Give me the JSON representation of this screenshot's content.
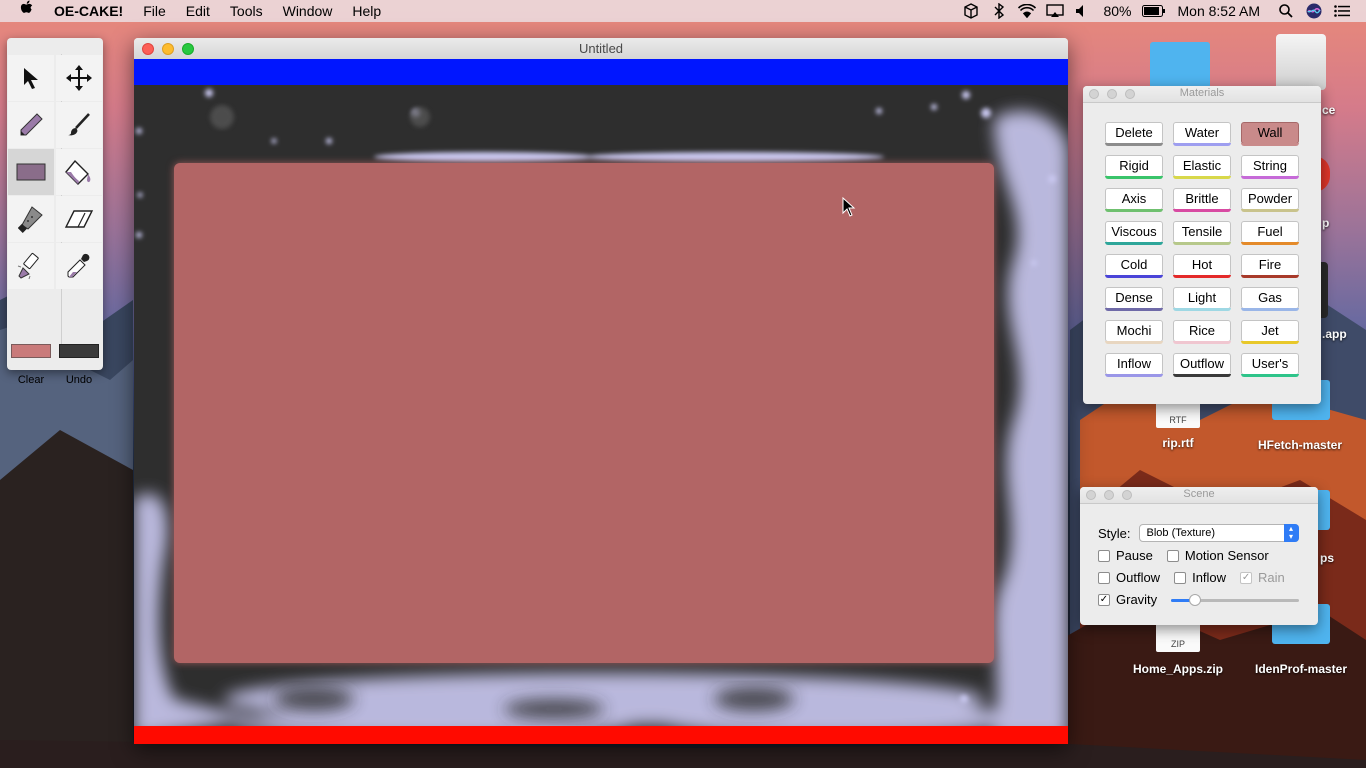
{
  "menubar": {
    "app_name": "OE-CAKE!",
    "menus": [
      "File",
      "Edit",
      "Tools",
      "Window",
      "Help"
    ],
    "battery": "80%",
    "clock": "Mon 8:52 AM",
    "icons": [
      "apple-icon",
      "box-icon",
      "bluetooth-icon",
      "wifi-icon",
      "airplay-icon",
      "volume-icon",
      "battery-icon",
      "search-icon",
      "siri-icon",
      "list-icon"
    ]
  },
  "palette": {
    "tools": [
      "select-arrow-icon",
      "move-icon",
      "pencil-icon",
      "brush-icon",
      "rectangle-icon",
      "paint-bucket-icon",
      "knife-icon",
      "eraser-icon",
      "flashlight-icon",
      "dropper-icon"
    ],
    "selected_tool": "rectangle-icon",
    "foreground_color": "#c97a7a",
    "background_color": "#3a3a3a",
    "clear_label": "Clear",
    "undo_label": "Undo"
  },
  "window": {
    "title": "Untitled"
  },
  "materials": {
    "title": "Materials",
    "selected": "Wall",
    "items": [
      {
        "label": "Delete",
        "color": "#8c8c8c"
      },
      {
        "label": "Water",
        "color": "#9e9ef0"
      },
      {
        "label": "Wall",
        "color": "#c98a8a"
      },
      {
        "label": "Rigid",
        "color": "#39c46a"
      },
      {
        "label": "Elastic",
        "color": "#d8d84a"
      },
      {
        "label": "String",
        "color": "#c66ad8"
      },
      {
        "label": "Axis",
        "color": "#6fc06f"
      },
      {
        "label": "Brittle",
        "color": "#d84aa2"
      },
      {
        "label": "Powder",
        "color": "#c9c38c"
      },
      {
        "label": "Viscous",
        "color": "#2ea69a"
      },
      {
        "label": "Tensile",
        "color": "#b6c88a"
      },
      {
        "label": "Fuel",
        "color": "#e48a2a"
      },
      {
        "label": "Cold",
        "color": "#4a44d8"
      },
      {
        "label": "Hot",
        "color": "#e42a2a"
      },
      {
        "label": "Fire",
        "color": "#a83a2a"
      },
      {
        "label": "Dense",
        "color": "#6f6aa8"
      },
      {
        "label": "Light",
        "color": "#9ed8e4"
      },
      {
        "label": "Gas",
        "color": "#9ab6e8"
      },
      {
        "label": "Mochi",
        "color": "#e8d6c0"
      },
      {
        "label": "Rice",
        "color": "#f0c6d0"
      },
      {
        "label": "Jet",
        "color": "#e8c82a"
      },
      {
        "label": "Inflow",
        "color": "#9a96e8"
      },
      {
        "label": "Outflow",
        "color": "#3a3a3a"
      },
      {
        "label": "User's",
        "color": "#2ec48a"
      }
    ]
  },
  "scene": {
    "title": "Scene",
    "style_label": "Style:",
    "style_value": "Blob (Texture)",
    "checkboxes": [
      {
        "label": "Pause",
        "checked": false
      },
      {
        "label": "Motion Sensor",
        "checked": false
      },
      {
        "label": "Outflow",
        "checked": false
      },
      {
        "label": "Inflow",
        "checked": false
      },
      {
        "label": "Rain",
        "checked": true,
        "disabled": true
      },
      {
        "label": "Gravity",
        "checked": true
      }
    ],
    "gravity_level": 0.19
  },
  "desktop_icons": [
    {
      "label": "rip.rtf",
      "kind": "RTF"
    },
    {
      "label": "HFetch-master",
      "kind": "folder"
    },
    {
      "label": "Home_Apps.zip",
      "kind": "ZIP"
    },
    {
      "label": "IdenProf-master",
      "kind": "folder"
    },
    {
      "label": ".app",
      "kind": "partial"
    },
    {
      "label": "ps",
      "kind": "partial"
    },
    {
      "label": "ce",
      "kind": "partial"
    },
    {
      "label": "p",
      "kind": "partial"
    }
  ]
}
